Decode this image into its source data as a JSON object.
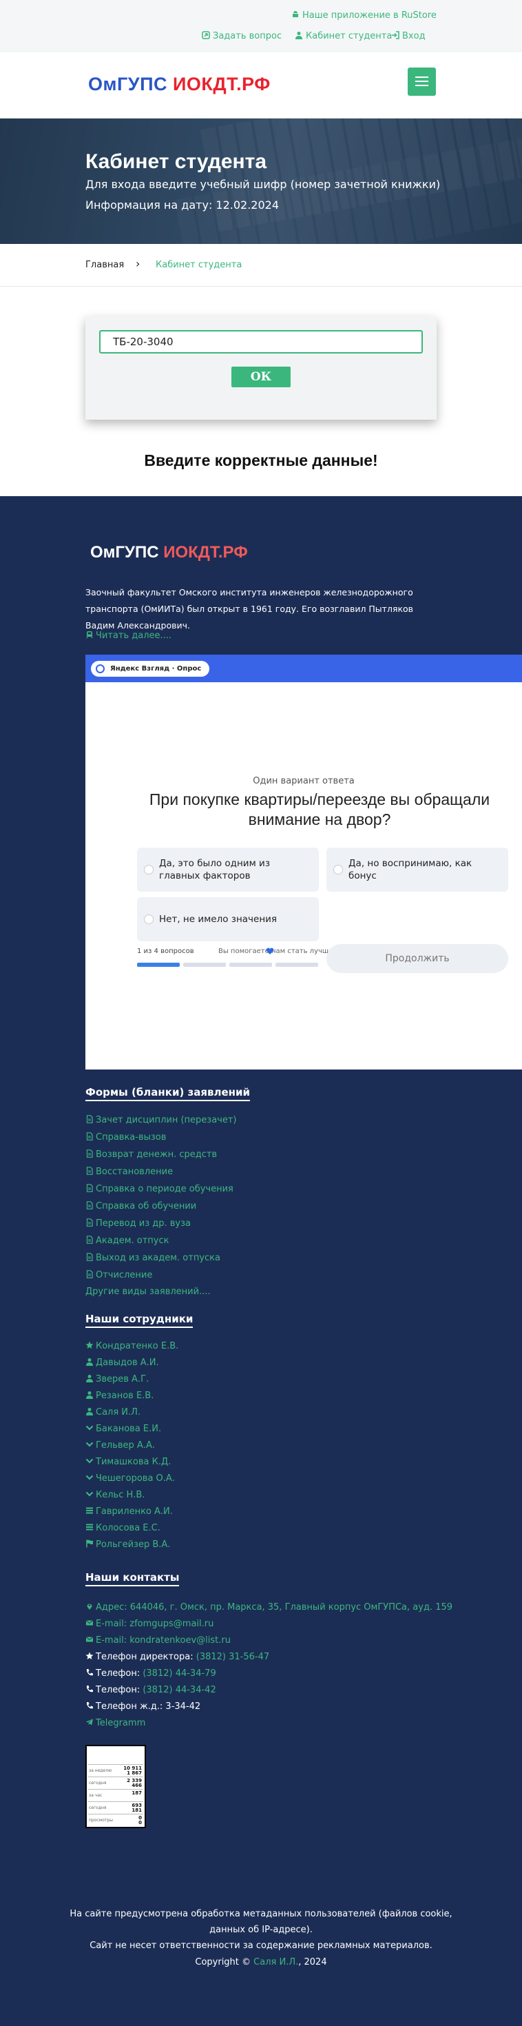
{
  "topbar": {
    "rustore": "Наше приложение в RuStore",
    "ask": "Задать вопрос",
    "cabinet": "Кабинет студента",
    "login": "Вход"
  },
  "header": {
    "logo_part1": "ОмГУПС",
    "logo_part2": "ИОКДТ.РФ"
  },
  "hero": {
    "title": "Кабинет студента",
    "line1": "Для входа введите учебный шифр (номер зачетной книжки)",
    "line2": "Информация на дату: 12.02.2024"
  },
  "breadcrumb": {
    "home": "Главная",
    "separator": "›",
    "current": "Кабинет студента"
  },
  "login_form": {
    "value": "ТБ-20-3040",
    "button": "ОК",
    "message": "Введите корректные данные!"
  },
  "footer": {
    "logo_part1": "ОмГУПС",
    "logo_part2": "ИОКДТ.РФ",
    "about": "Заочный факультет Омского института инженеров железнодорожного транспорта (ОмИИТа) был открыт в 1961 году. Его возглавил Пытляков Вадим Александрович.",
    "read_more": "Читать далее....",
    "poll": {
      "tag": "Яндекс Взгляд · Опрос",
      "kind": "Один вариант ответа",
      "question": "При покупке квартиры/переезде вы обращали внимание на двор?",
      "options": [
        "Да, это было одним из главных факторов",
        "Да, но воспринимаю, как бонус",
        "Нет, не имело значения"
      ],
      "progress": "1 из 4 вопросов",
      "progress_current": 1,
      "progress_total": 4,
      "thanks": "Вы помогаете нам стать лучше",
      "continue": "Продолжить"
    },
    "forms_heading": "Формы (бланки) заявлений",
    "forms": [
      "Зачет дисциплин (перезачет)",
      "Справка-вызов",
      "Возврат денежн. средств",
      "Восстановление",
      "Справка о периоде обучения",
      "Справка об обучении",
      "Перевод из др. вуза",
      "Академ. отпуск",
      "Выход из академ. отпуска",
      "Отчисление"
    ],
    "forms_more": "Другие виды заявлений....",
    "staff_heading": "Наши сотрудники",
    "staff": [
      {
        "name": "Кондратенко Е.В.",
        "icon": "star-icon"
      },
      {
        "name": "Давыдов А.И.",
        "icon": "user-icon"
      },
      {
        "name": "Зверев А.Г.",
        "icon": "user-icon"
      },
      {
        "name": "Резанов Е.В.",
        "icon": "user-icon"
      },
      {
        "name": "Саля И.Л.",
        "icon": "user-icon"
      },
      {
        "name": "Баканова Е.И.",
        "icon": "chevron-down-icon"
      },
      {
        "name": "Гельвер А.А.",
        "icon": "chevron-down-icon"
      },
      {
        "name": "Тимашкова К.Д.",
        "icon": "chevron-down-icon"
      },
      {
        "name": "Чешегорова О.А.",
        "icon": "chevron-down-icon"
      },
      {
        "name": "Кельс Н.В.",
        "icon": "chevron-down-icon"
      },
      {
        "name": "Гавриленко А.И.",
        "icon": "list-icon"
      },
      {
        "name": "Колосова Е.С.",
        "icon": "list-icon"
      },
      {
        "name": "Рольгейзер В.А.",
        "icon": "flag-icon"
      }
    ],
    "contacts_heading": "Наши контакты",
    "contacts": {
      "address": "Адрес: 644046, г. Омск, пр. Маркса, 35, Главный корпус ОмГУПСа, ауд. 159",
      "email1": "E-mail: zfomgups@mail.ru",
      "email2": "E-mail: kondratenkoev@list.ru",
      "director_label": "Телефон директора:",
      "director_phone": "(3812) 31-56-47",
      "phone1_label": "Телефон:",
      "phone1": "(3812) 44-34-79",
      "phone2_label": "Телефон:",
      "phone2": "(3812) 44-34-42",
      "rail_phone": "Телефон ж.д.: 3-34-42",
      "telegram": "Telegramm"
    },
    "counter": {
      "rows": [
        {
          "label": "за неделю",
          "nums": "10 911\n1 867"
        },
        {
          "label": "сегодня",
          "nums": "2 339\n466"
        },
        {
          "label": "за час",
          "nums": "187"
        },
        {
          "label": "сегодня",
          "nums": "693\n181"
        },
        {
          "label": "просмотры",
          "nums": "0\n0"
        }
      ]
    },
    "note1": "На сайте предусмотрена обработка метаданных пользователей (файлов cookie,",
    "note2": "данных об IP-адресе).",
    "note3": "Сайт не несет ответственности за содержание рекламных материалов.",
    "copyright_prefix": "Copyright ©",
    "copyright_name": "Саля И.Л.",
    "copyright_year": ", 2024"
  },
  "colors": {
    "accent": "#3bb77e",
    "footer_bg": "#1c2d55",
    "poll_header": "#3a64e8",
    "logo_blue": "#2a55c5",
    "logo_red": "#e8232e"
  }
}
